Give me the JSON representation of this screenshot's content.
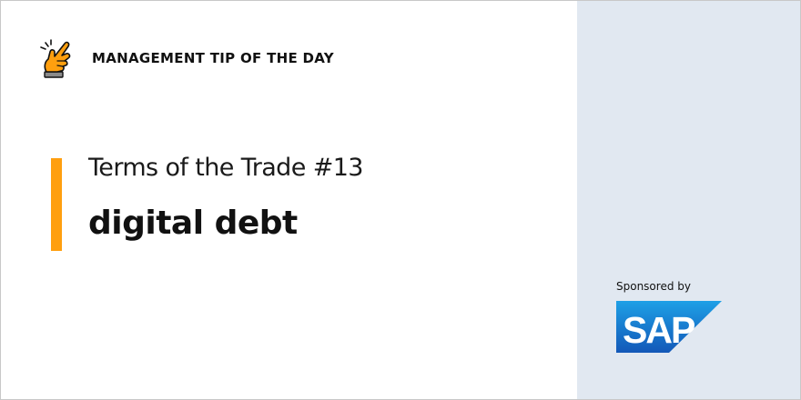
{
  "header": {
    "icon": "pointing-finger-icon",
    "label": "MANAGEMENT TIP OF THE DAY"
  },
  "main": {
    "series_title": "Terms of the Trade #13",
    "term": "digital debt"
  },
  "sponsor": {
    "label": "Sponsored by",
    "logo_text": "SAP"
  },
  "colors": {
    "accent": "#ff9f0f",
    "side_panel": "#e1e8f1",
    "sap_blue": "#1a6fc9"
  }
}
